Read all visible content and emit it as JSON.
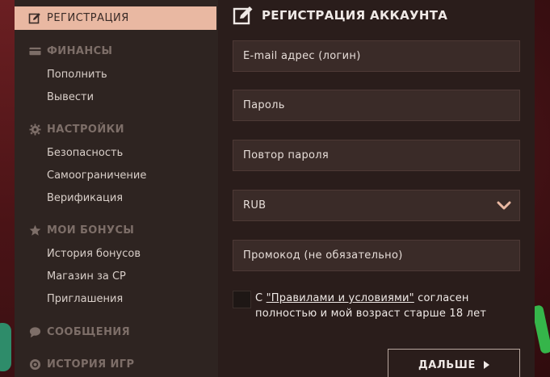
{
  "sidebar": {
    "active": "РЕГИСТРАЦИЯ",
    "finance": {
      "title": "ФИНАНСЫ",
      "items": [
        "Пополнить",
        "Вывести"
      ]
    },
    "settings": {
      "title": "НАСТРОЙКИ",
      "items": [
        "Безопасность",
        "Самоограничение",
        "Верификация"
      ]
    },
    "bonuses": {
      "title": "МОИ БОНУСЫ",
      "items": [
        "История бонусов",
        "Магазин за CP",
        "Приглашения"
      ]
    },
    "messages": {
      "title": "СООБЩЕНИЯ"
    },
    "history": {
      "title": "ИСТОРИЯ ИГР"
    }
  },
  "form": {
    "title": "РЕГИСТРАЦИЯ АККАУНТА",
    "email_placeholder": "E-mail адрес (логин)",
    "password_placeholder": "Пароль",
    "password_repeat_placeholder": "Повтор пароля",
    "currency": "RUB",
    "promo_placeholder": "Промокод (не обязательно)",
    "terms_prefix": "С ",
    "terms_link": "\"Правилами и условиями\"",
    "terms_suffix": " согласен полностью и мой возраст старше 18 лет",
    "next_label": "ДАЛЬШЕ"
  },
  "colors": {
    "accent": "#e9b8a2",
    "sidebar_bg": "#2e2421",
    "panel_bg": "#2a1d1b",
    "field_bg": "#3a2b28"
  }
}
